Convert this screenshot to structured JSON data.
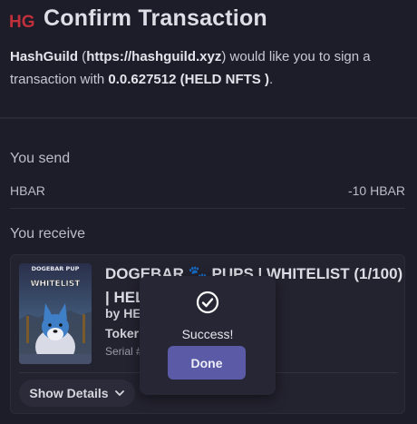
{
  "header": {
    "logo": "HG",
    "title": "Confirm Transaction",
    "app_name": "HashGuild",
    "app_url": "https://hashguild.xyz",
    "desc_mid": ") would like you to sign a transaction with ",
    "account": "0.0.627512",
    "account_label": "(HELD NFTS )",
    "desc_end": "."
  },
  "send": {
    "label": "You send",
    "asset": "HBAR",
    "amount": "-10 HBAR"
  },
  "receive": {
    "label": "You receive",
    "nft": {
      "image_text": "DOGEBAR PUP\nWHITELIST",
      "name_line1": "DOGEBAR 🐾 PUPS | WHITELIST (1/100)",
      "name_line2": "| HEL",
      "by": "by HE",
      "token": "Toker",
      "serial": "Serial #",
      "show_details": "Show Details"
    }
  },
  "modal": {
    "message": "Success!",
    "button": "Done",
    "icon": "check-circle-icon"
  },
  "colors": {
    "background": "#1d1c29",
    "card": "#23222f",
    "accent": "#5a5aa6",
    "logo_red": "#c0303a"
  }
}
